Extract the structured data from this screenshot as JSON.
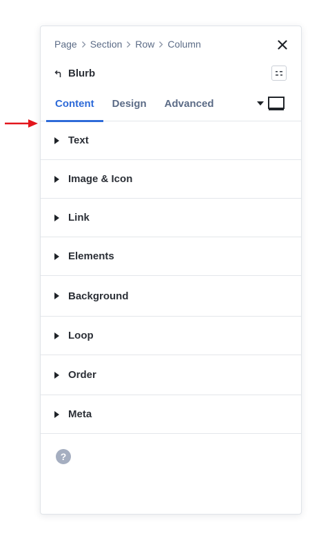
{
  "breadcrumb": [
    "Page",
    "Section",
    "Row",
    "Column"
  ],
  "module": {
    "name": "Blurb"
  },
  "tabs": [
    {
      "label": "Content",
      "active": true
    },
    {
      "label": "Design",
      "active": false
    },
    {
      "label": "Advanced",
      "active": false
    }
  ],
  "sections": [
    {
      "label": "Text"
    },
    {
      "label": "Image & Icon"
    },
    {
      "label": "Link"
    },
    {
      "label": "Elements"
    },
    {
      "label": "Background"
    },
    {
      "label": "Loop"
    },
    {
      "label": "Order"
    },
    {
      "label": "Meta"
    }
  ],
  "help": {
    "glyph": "?"
  },
  "colors": {
    "accent": "#2d6ad8",
    "annotation_arrow": "#e3161c",
    "muted_text": "#5b6b86"
  },
  "icons": {
    "close": "close-icon",
    "back": "back-arrow-icon",
    "settings": "settings-toggle-icon",
    "responsive_caret": "caret-down-icon",
    "device": "desktop-view-icon",
    "section_toggle": "caret-right-icon",
    "help": "help-icon",
    "annotation": "red-arrow-icon"
  }
}
